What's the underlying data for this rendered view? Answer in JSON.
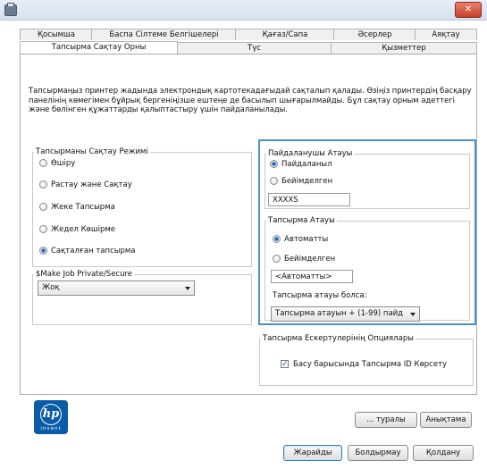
{
  "window": {
    "close_label": "✕"
  },
  "tabs_row1": [
    "Қосымша",
    "Баспа Сілтеме Белгішелері",
    "Қағаз/Сапа",
    "Әсерлер",
    "Аяқтау"
  ],
  "tabs_row2": [
    "Тапсырма Сақтау Орны",
    "Түс",
    "Қызметтер"
  ],
  "description": "Тапсырмаңыз принтер жадында электрондық картотекадағыдай сақталып қалады. Өзіңіз принтердің басқару панелінің көмегімен бұйрық бергеніңізше ештеңе де басылып шығарылмайды. Бұл сақтау орным әдеттегі және бөлінген құжаттарды қалыптастыру үшін пайдаланылады.",
  "storage_mode": {
    "legend": "Тапсырманы Сақтау Режимі",
    "options": [
      "Өшіру",
      "Растау және Сақтау",
      "Жеке Тапсырма",
      "Жедел Көшірме",
      "Сақталған тапсырма"
    ],
    "selected_index": 4
  },
  "private": {
    "legend": "$Make Job Private/Secure",
    "value": "Жоқ"
  },
  "user_name": {
    "legend": "Пайдаланушы Атауы",
    "options": [
      "Пайдаланыл",
      "Бейімделген"
    ],
    "selected_index": 0,
    "value": "XXXXS"
  },
  "job_name": {
    "legend": "Тапсырма Атауы",
    "options": [
      "Автоматты",
      "Бейімделген"
    ],
    "selected_index": 0,
    "value": "<Автоматты>",
    "if_exists_label": "Тапсырма атауы болса:",
    "if_exists_value": "Тапсырма атауын + (1-99) пайд"
  },
  "notification": {
    "legend": "Тапсырма Ескертулерінің Опциялары",
    "checkbox_label": "Басу барысында Тапсырма ID Көрсету",
    "checked": true
  },
  "logo": {
    "text": "hp",
    "tagline": "invent"
  },
  "buttons": {
    "about": "... туралы",
    "help": "Анықтама",
    "ok": "Жарайды",
    "cancel": "Болдырмау",
    "apply": "Қолдану"
  }
}
